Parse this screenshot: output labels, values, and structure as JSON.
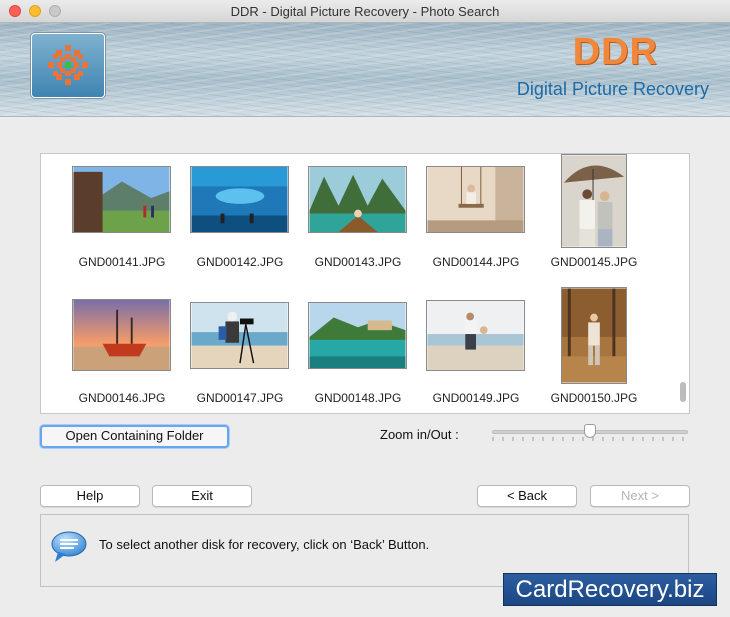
{
  "window": {
    "title": "DDR - Digital Picture Recovery - Photo Search"
  },
  "banner": {
    "brand": "DDR",
    "subtitle": "Digital Picture Recovery"
  },
  "gallery": {
    "rows": [
      [
        {
          "name": "GND00141.JPG"
        },
        {
          "name": "GND00142.JPG"
        },
        {
          "name": "GND00143.JPG"
        },
        {
          "name": "GND00144.JPG"
        },
        {
          "name": "GND00145.JPG"
        }
      ],
      [
        {
          "name": "GND00146.JPG"
        },
        {
          "name": "GND00147.JPG"
        },
        {
          "name": "GND00148.JPG"
        },
        {
          "name": "GND00149.JPG"
        },
        {
          "name": "GND00150.JPG"
        }
      ]
    ]
  },
  "controls": {
    "open_folder_label": "Open Containing Folder",
    "zoom_label": "Zoom in/Out :",
    "zoom_level": 0.5
  },
  "buttons": {
    "help": "Help",
    "exit": "Exit",
    "back": "< Back",
    "next": "Next >"
  },
  "info": {
    "message": "To select another disk for recovery, click on ‘Back’ Button."
  },
  "watermark": {
    "text": "CardRecovery.biz"
  },
  "colors": {
    "brand": "#f0873a",
    "subtitle": "#1c6aa8",
    "watermark_bg": "#1c4683"
  }
}
